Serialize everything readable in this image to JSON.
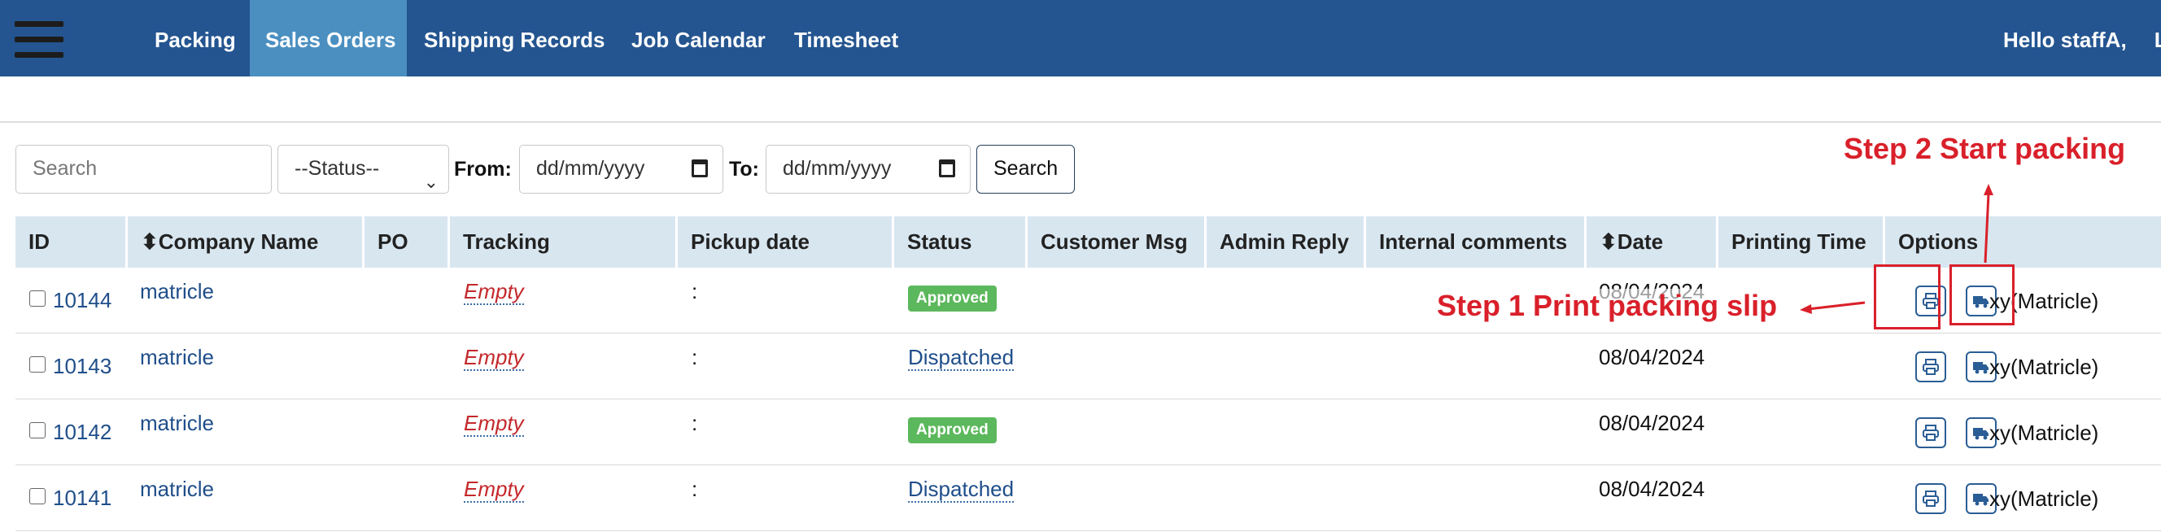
{
  "nav": {
    "items": [
      {
        "label": "Packing",
        "active": false
      },
      {
        "label": "Sales Orders",
        "active": true
      },
      {
        "label": "Shipping Records",
        "active": false
      },
      {
        "label": "Job Calendar",
        "active": false
      },
      {
        "label": "Timesheet",
        "active": false
      }
    ],
    "greeting": "Hello staffA,",
    "trailing": "L"
  },
  "filters": {
    "search_placeholder": "Search",
    "status_value": "--Status--",
    "from_label": "From:",
    "from_placeholder": "dd/mm/yyyy",
    "to_label": "To:",
    "to_placeholder": "dd/mm/yyyy",
    "search_button": "Search"
  },
  "table": {
    "headers": [
      "ID",
      "⬍Company Name",
      "PO",
      "Tracking",
      "Pickup date",
      "Status",
      "Customer Msg",
      "Admin Reply",
      "Internal comments",
      "⬍Date",
      "Printing Time",
      "Options"
    ],
    "rows": [
      {
        "id": "10144",
        "company": "matricle",
        "tracking": "Empty",
        "pickup": ":",
        "status": "Approved",
        "date": "08/04/2024",
        "option_user": "xy(Matricle)"
      },
      {
        "id": "10143",
        "company": "matricle",
        "tracking": "Empty",
        "pickup": ":",
        "status": "Dispatched",
        "date": "08/04/2024",
        "option_user": "xy(Matricle)"
      },
      {
        "id": "10142",
        "company": "matricle",
        "tracking": "Empty",
        "pickup": ":",
        "status": "Approved",
        "date": "08/04/2024",
        "option_user": "xy(Matricle)"
      },
      {
        "id": "10141",
        "company": "matricle",
        "tracking": "Empty",
        "pickup": ":",
        "status": "Dispatched",
        "date": "08/04/2024",
        "option_user": "xy(Matricle)"
      }
    ]
  },
  "annotations": {
    "step1": "Step 1 Print packing slip",
    "step2": "Step 2 Start packing"
  },
  "colors": {
    "nav_bg": "#245590",
    "nav_active": "#4a8fc0",
    "header_bg": "#d8e6f0",
    "badge_approved": "#5cb85c",
    "annotation_red": "#d9202a",
    "link": "#1f4e8a"
  },
  "icons": {
    "menu": "hamburger-icon",
    "print": "printer-icon",
    "ship": "truck-icon",
    "calendar": "calendar-icon"
  }
}
